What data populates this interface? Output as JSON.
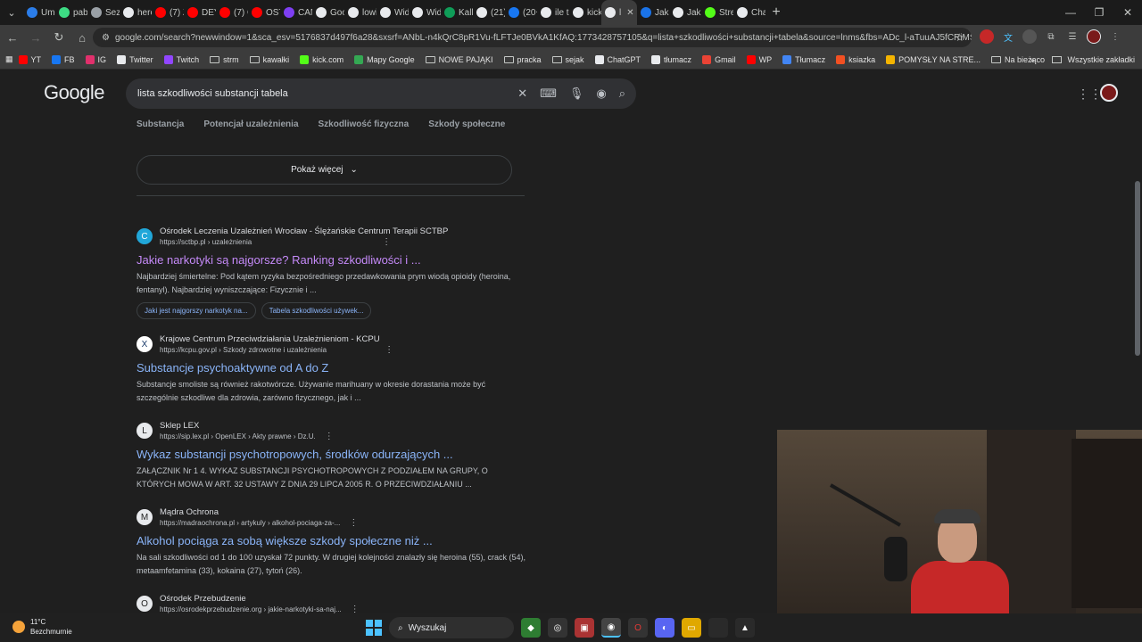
{
  "browser": {
    "tabs": [
      {
        "label": "Umó",
        "color": "#2b7de9"
      },
      {
        "label": "pabi",
        "color": "#3ddc84"
      },
      {
        "label": "Sezo",
        "color": "#9aa0a6"
      },
      {
        "label": "hero",
        "color": "#e8eaed"
      },
      {
        "label": "(7) Z",
        "color": "#ff0000"
      },
      {
        "label": "DEY",
        "color": "#ff0000"
      },
      {
        "label": "(7) C",
        "color": "#ff0000"
      },
      {
        "label": "OST",
        "color": "#ff0000"
      },
      {
        "label": "CAN",
        "color": "#7e3ff2"
      },
      {
        "label": "Goo",
        "color": "#e8eaed"
      },
      {
        "label": "lowi",
        "color": "#e8eaed"
      },
      {
        "label": "Wid",
        "color": "#e8eaed"
      },
      {
        "label": "Wid",
        "color": "#e8eaed"
      },
      {
        "label": "Kalk",
        "color": "#0f9d58"
      },
      {
        "label": "(21)",
        "color": "#e8eaed"
      },
      {
        "label": "(20+",
        "color": "#1877f2"
      },
      {
        "label": "ile tr",
        "color": "#e8eaed"
      },
      {
        "label": "kick",
        "color": "#e8eaed"
      },
      {
        "label": "l",
        "color": "#e8eaed"
      },
      {
        "label": "Jaki",
        "color": "#1a73e8"
      },
      {
        "label": "Jakie",
        "color": "#e8eaed"
      },
      {
        "label": "Stre",
        "color": "#53fc18"
      },
      {
        "label": "Cha",
        "color": "#e8eaed"
      }
    ],
    "active_tab_index": 18,
    "url": "google.com/search?newwindow=1&sca_esv=5176837d497f6a28&sxsrf=ANbL-n4kQrC8pR1Vu-fLFTJe0BVkA1KfAQ:1773428757105&q=lista+szkodliwości+substancji+tabela&source=lnms&fbs=ADc_l-aTuuAJ5fCRiMSMSikFOr...",
    "bookmarks": [
      {
        "label": "YT",
        "color": "#ff0000"
      },
      {
        "label": "FB",
        "color": "#1877f2"
      },
      {
        "label": "IG",
        "color": "#e1306c"
      },
      {
        "label": "Twitter",
        "color": "#e8eaed"
      },
      {
        "label": "Twitch",
        "color": "#9146ff"
      },
      {
        "label": "strm",
        "color": "folder"
      },
      {
        "label": "kawałki",
        "color": "folder"
      },
      {
        "label": "kick.com",
        "color": "#53fc18"
      },
      {
        "label": "Mapy Google",
        "color": "#34a853"
      },
      {
        "label": "NOWE PAJĄKI",
        "color": "folder"
      },
      {
        "label": "pracka",
        "color": "folder"
      },
      {
        "label": "sejak",
        "color": "folder"
      },
      {
        "label": "ChatGPT",
        "color": "#e8eaed"
      },
      {
        "label": "tłumacz",
        "color": "#e8eaed"
      },
      {
        "label": "Gmail",
        "color": "#ea4335"
      },
      {
        "label": "WP",
        "color": "#ff0000"
      },
      {
        "label": "Tłumacz",
        "color": "#4285f4"
      },
      {
        "label": "ksiazka",
        "color": "#f25022"
      },
      {
        "label": "POMYSŁY NA STRE...",
        "color": "#f4b400"
      },
      {
        "label": "Na bieżąco",
        "color": "folder"
      }
    ],
    "bookmarks_all": "Wszystkie zakładki"
  },
  "google": {
    "logo": "Google",
    "query": "lista szkodliwości substancji tabela",
    "table_headers": [
      "Substancja",
      "Potencjał uzależnienia",
      "Szkodliwość fizyczna",
      "Szkody społeczne"
    ],
    "show_more": "Pokaż więcej",
    "results": [
      {
        "site": "Ośrodek Leczenia Uzależnień Wrocław - Ślężańskie Centrum Terapii SCTBP",
        "url": "https://sctbp.pl › uzależnienia",
        "title": "Jakie narkotyki są najgorsze? Ranking szkodliwości i ...",
        "snippet": "Najbardziej śmiertelne: Pod kątem ryzyka bezpośredniego przedawkowania prym wiodą opioidy (heroina, fentanyl). Najbardziej wyniszczające: Fizycznie i ...",
        "chips": [
          "Jaki jest najgorszy narkotyk na...",
          "Tabela szkodliwości używek..."
        ],
        "visited": true,
        "fav": "C"
      },
      {
        "site": "Krajowe Centrum Przeciwdziałania Uzależnieniom - KCPU",
        "url": "https://kcpu.gov.pl › Szkody zdrowotne i uzależnienia",
        "title": "Substancje psychoaktywne od A do Z",
        "snippet": "Substancje smoliste są również rakotwórcze. Używanie marihuany w okresie dorastania może być szczególnie szkodliwe dla zdrowia, zarówno fizycznego, jak i ...",
        "visited": false,
        "fav": "X"
      },
      {
        "site": "Sklep LEX",
        "url": "https://sip.lex.pl › OpenLEX › Akty prawne › Dz.U.",
        "title": "Wykaz substancji psychotropowych, środków odurzających ...",
        "snippet": "ZAŁĄCZNIK Nr 1 4. WYKAZ SUBSTANCJI PSYCHOTROPOWYCH Z PODZIAŁEM NA GRUPY, O KTÓRYCH MOWA W ART. 32 USTAWY Z DNIA 29 LIPCA 2005 R. O PRZECIWDZIAŁANIU ...",
        "visited": false,
        "fav": "L"
      },
      {
        "site": "Mądra Ochrona",
        "url": "https://madraochrona.pl › artykuly › alkohol-pociaga-za-...",
        "title": "Alkohol pociąga za sobą większe szkody społeczne niż ...",
        "snippet": "Na sali szkodliwości od 1 do 100 uzyskał 72 punkty. W drugiej kolejności znalazły się heroina (55), crack (54), metaamfetamina (33), kokaina (27), tytoń (26).",
        "visited": false,
        "fav": "M"
      },
      {
        "site": "Ośrodek Przebudzenie",
        "url": "https://osrodekprzebudzenie.org › jakie-narkotyki-sa-naj...",
        "visited": false,
        "fav": "O"
      }
    ]
  },
  "taskbar": {
    "temp": "11°C",
    "weather": "Bezchmurnie",
    "search": "Wyszukaj"
  }
}
